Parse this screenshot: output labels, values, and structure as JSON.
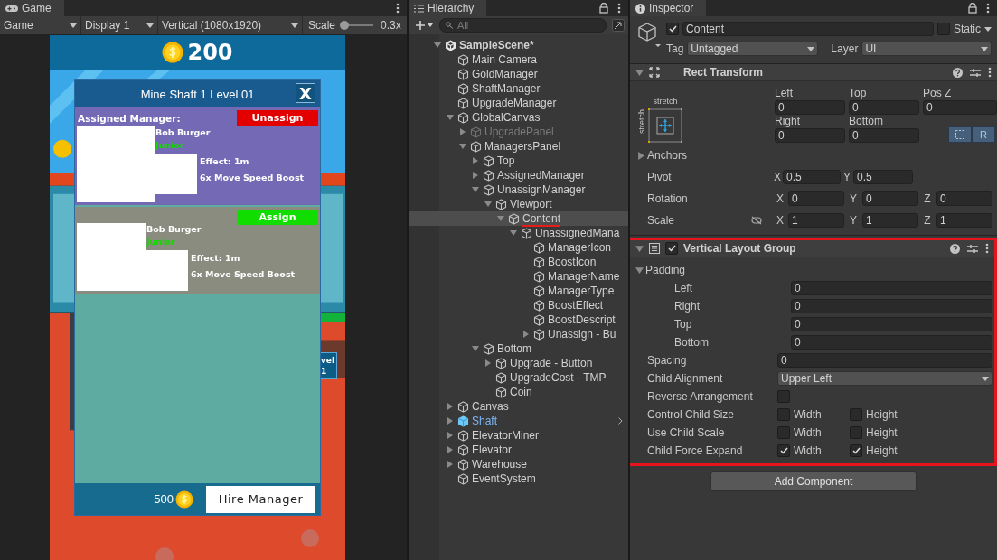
{
  "game": {
    "tab": "Game",
    "toolbar": {
      "view": "Game",
      "display": "Display 1",
      "resolution": "Vertical (1080x1920)",
      "scale_label": "Scale",
      "scale": {
        "level": 0.05
      },
      "scale_value": "0.3x"
    },
    "gold": "200",
    "side_label": [
      "vel",
      "1"
    ],
    "panel": {
      "title": "Mine Shaft 1 Level 01",
      "close": "X",
      "cards": [
        {
          "kind": "assigned",
          "heading": "Assigned Manager:",
          "action": "Unassign",
          "name": "Bob Burger",
          "type": "Junior",
          "effect": "Effect: 1m",
          "description": "6x Move Speed Boost"
        },
        {
          "kind": "unassigned",
          "action": "Assign",
          "name": "Bob Burger",
          "type": "Junior",
          "effect": "Effect: 1m",
          "description": "6x Move Speed Boost"
        }
      ],
      "cost": "500",
      "hire": "Hire Manager"
    }
  },
  "hierarchy": {
    "title": "Hierarchy",
    "search_placeholder": "All",
    "tree": [
      {
        "label": "SampleScene*",
        "kind": "scene",
        "selected": false,
        "underlined": false,
        "expanded": true,
        "children": [
          {
            "label": "Main Camera",
            "kind": "object",
            "selected": false,
            "underlined": false
          },
          {
            "label": "GoldManager",
            "kind": "object",
            "selected": false,
            "underlined": false
          },
          {
            "label": "ShaftManager",
            "kind": "object",
            "selected": false,
            "underlined": false
          },
          {
            "label": "UpgradeManager",
            "kind": "object",
            "selected": false,
            "underlined": false
          },
          {
            "label": "GlobalCanvas",
            "kind": "object",
            "selected": false,
            "underlined": false,
            "expanded": true,
            "children": [
              {
                "label": "UpgradePanel",
                "kind": "inactive",
                "selected": false,
                "underlined": false,
                "expanded": false
              },
              {
                "label": "ManagersPanel",
                "kind": "object",
                "selected": false,
                "underlined": false,
                "expanded": true,
                "children": [
                  {
                    "label": "Top",
                    "kind": "object",
                    "selected": false,
                    "underlined": false,
                    "expanded": false
                  },
                  {
                    "label": "AssignedManager",
                    "kind": "object",
                    "selected": false,
                    "underlined": false,
                    "expanded": false
                  },
                  {
                    "label": "UnassignManager",
                    "kind": "object",
                    "selected": false,
                    "underlined": false,
                    "expanded": true,
                    "children": [
                      {
                        "label": "Viewport",
                        "kind": "object",
                        "selected": false,
                        "underlined": false,
                        "expanded": true,
                        "children": [
                          {
                            "label": "Content",
                            "kind": "object",
                            "selected": true,
                            "underlined": true,
                            "expanded": true,
                            "children": [
                              {
                                "label": "UnassignedMana",
                                "kind": "object",
                                "selected": false,
                                "underlined": false,
                                "expanded": true,
                                "children": [
                                  {
                                    "label": "ManagerIcon",
                                    "kind": "object",
                                    "selected": false,
                                    "underlined": false
                                  },
                                  {
                                    "label": "BoostIcon",
                                    "kind": "object",
                                    "selected": false,
                                    "underlined": false
                                  },
                                  {
                                    "label": "ManagerName",
                                    "kind": "object",
                                    "selected": false,
                                    "underlined": false
                                  },
                                  {
                                    "label": "ManagerType",
                                    "kind": "object",
                                    "selected": false,
                                    "underlined": false
                                  },
                                  {
                                    "label": "BoostEffect",
                                    "kind": "object",
                                    "selected": false,
                                    "underlined": false
                                  },
                                  {
                                    "label": "BoostDescript",
                                    "kind": "object",
                                    "selected": false,
                                    "underlined": false
                                  },
                                  {
                                    "label": "Unassign - Bu",
                                    "kind": "object",
                                    "selected": false,
                                    "underlined": false,
                                    "expanded": false
                                  }
                                ]
                              }
                            ]
                          }
                        ]
                      }
                    ]
                  },
                  {
                    "label": "Bottom",
                    "kind": "object",
                    "selected": false,
                    "underlined": false,
                    "expanded": true,
                    "children": [
                      {
                        "label": "Upgrade - Button",
                        "kind": "object",
                        "selected": false,
                        "underlined": false,
                        "expanded": false
                      },
                      {
                        "label": "UpgradeCost - TMP",
                        "kind": "object",
                        "selected": false,
                        "underlined": false
                      },
                      {
                        "label": "Coin",
                        "kind": "object",
                        "selected": false,
                        "underlined": false
                      }
                    ]
                  }
                ]
              }
            ]
          },
          {
            "label": "Canvas",
            "kind": "object",
            "selected": false,
            "underlined": false,
            "expanded": false
          },
          {
            "label": "Shaft",
            "kind": "prefab",
            "selected": false,
            "underlined": false,
            "expanded": false
          },
          {
            "label": "ElevatorMiner",
            "kind": "object",
            "selected": false,
            "underlined": false,
            "expanded": false
          },
          {
            "label": "Elevator",
            "kind": "object",
            "selected": false,
            "underlined": false,
            "expanded": false
          },
          {
            "label": "Warehouse",
            "kind": "object",
            "selected": false,
            "underlined": false,
            "expanded": false
          },
          {
            "label": "EventSystem",
            "kind": "object",
            "selected": false,
            "underlined": false
          }
        ]
      }
    ]
  },
  "inspector": {
    "title": "Inspector",
    "object": {
      "active": true,
      "name": "Content",
      "static_label": "Static",
      "static": false,
      "tag_label": "Tag",
      "tag": "Untagged",
      "layer_label": "Layer",
      "layer": "UI"
    },
    "rect_transform": {
      "title": "Rect Transform",
      "anchor_h": "stretch",
      "anchor_v": "stretch",
      "fields": [
        {
          "label": "Left",
          "value": "0"
        },
        {
          "label": "Top",
          "value": "0"
        },
        {
          "label": "Pos Z",
          "value": "0"
        },
        {
          "label": "Right",
          "value": "0"
        },
        {
          "label": "Bottom",
          "value": "0"
        }
      ],
      "raw_button": "R",
      "anchors": "Anchors",
      "anchors_expanded": false,
      "rows": [
        {
          "label": "Pivot",
          "kind": "pivot",
          "axes": [
            {
              "axis": "X",
              "value": "0.5"
            },
            {
              "axis": "Y",
              "value": "0.5"
            }
          ]
        },
        {
          "label": "Rotation",
          "kind": "vector",
          "axes": [
            {
              "axis": "X",
              "value": "0"
            },
            {
              "axis": "Y",
              "value": "0"
            },
            {
              "axis": "Z",
              "value": "0"
            }
          ]
        },
        {
          "label": "Scale",
          "kind": "scale",
          "axes": [
            {
              "axis": "X",
              "value": "1"
            },
            {
              "axis": "Y",
              "value": "1"
            },
            {
              "axis": "Z",
              "value": "1"
            }
          ]
        }
      ]
    },
    "layout_group": {
      "title": "Vertical Layout Group",
      "enabled": true,
      "highlighted": true,
      "padding": {
        "label": "Padding",
        "expanded": true,
        "fields": [
          {
            "label": "Left",
            "value": "0"
          },
          {
            "label": "Right",
            "value": "0"
          },
          {
            "label": "Top",
            "value": "0"
          },
          {
            "label": "Bottom",
            "value": "0"
          }
        ]
      },
      "spacing": {
        "label": "Spacing",
        "value": "0"
      },
      "alignment": {
        "label": "Child Alignment",
        "value": "Upper Left"
      },
      "reverse": {
        "label": "Reverse Arrangement",
        "checked": false
      },
      "toggles": [
        {
          "label": "Control Child Size",
          "width": {
            "label": "Width",
            "checked": false
          },
          "height": {
            "label": "Height",
            "checked": false
          }
        },
        {
          "label": "Use Child Scale",
          "width": {
            "label": "Width",
            "checked": false
          },
          "height": {
            "label": "Height",
            "checked": false
          }
        },
        {
          "label": "Child Force Expand",
          "width": {
            "label": "Width",
            "checked": true
          },
          "height": {
            "label": "Height",
            "checked": true
          }
        }
      ]
    },
    "add_component": "Add Component"
  }
}
